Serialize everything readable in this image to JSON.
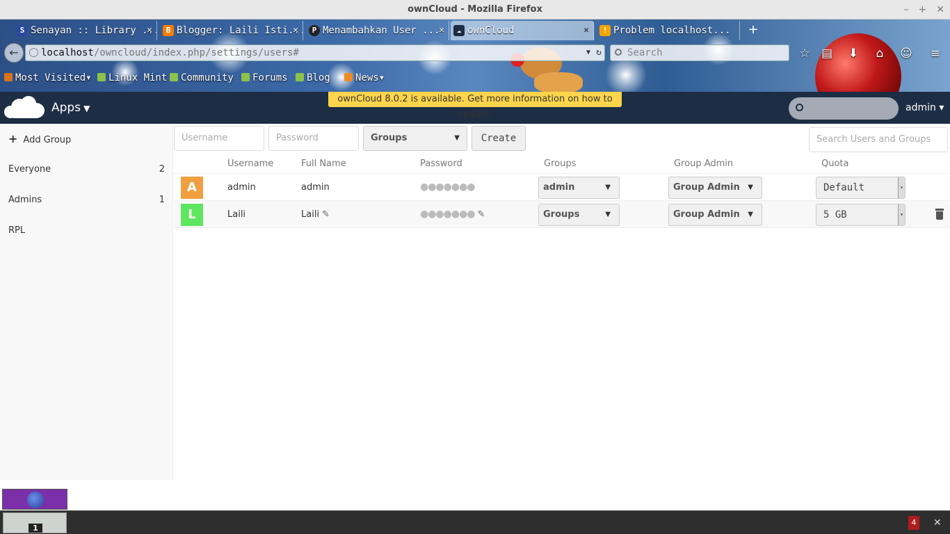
{
  "window": {
    "title": "ownCloud - Mozilla Firefox",
    "minimize": "–",
    "maximize": "+",
    "close": "✕"
  },
  "browser": {
    "tabs": [
      {
        "label": "Senayan :: Library ...",
        "icon_color": "#2a4a9c",
        "icon": "S",
        "icon_name": "senayan-icon"
      },
      {
        "label": "Blogger: Laili Isti...",
        "icon_color": "#f57d00",
        "icon": "B",
        "icon_name": "blogger-icon"
      },
      {
        "label": "Menambahkan User ...",
        "icon_color": "#222222",
        "icon": "P",
        "icon_name": "pinterest-icon"
      },
      {
        "label": "ownCloud",
        "icon_color": "#1d2d44",
        "icon": "☁",
        "icon_name": "owncloud-icon"
      },
      {
        "label": "Problem localhost...",
        "icon_color": "#f5a500",
        "icon": "!",
        "icon_name": "problem-icon"
      }
    ],
    "tab_close": "✕",
    "new_tab": "+",
    "url_host": "localhost",
    "url_path": "/owncloud/index.php/settings/users#",
    "search_placeholder": "Search",
    "bookmarks": [
      {
        "label": "Most Visited",
        "caret": "▾"
      },
      {
        "label": "Linux Mint",
        "caret": ""
      },
      {
        "label": "Community",
        "caret": ""
      },
      {
        "label": "Forums",
        "caret": ""
      },
      {
        "label": "Blog",
        "caret": ""
      },
      {
        "label": "News",
        "caret": "▾"
      }
    ]
  },
  "owncloud": {
    "apps_label": "Apps",
    "apps_caret": "▼",
    "update_notice": "ownCloud 8.0.2 is available. Get more information on how to update.",
    "user": "admin ▾"
  },
  "sidebar": {
    "add_group": "Add Group",
    "groups": [
      {
        "name": "Everyone",
        "count": "2"
      },
      {
        "name": "Admins",
        "count": "1"
      },
      {
        "name": "RPL",
        "count": ""
      }
    ]
  },
  "create_form": {
    "username_placeholder": "Username",
    "password_placeholder": "Password",
    "groups_select": "Groups",
    "create_button": "Create",
    "search_placeholder": "Search Users and Groups"
  },
  "table": {
    "headers": [
      "Username",
      "Full Name",
      "Password",
      "Groups",
      "Group Admin",
      "Quota"
    ],
    "rows": [
      {
        "avatar": "A",
        "avatar_color": "#f0a040",
        "username": "admin",
        "fullname": "admin",
        "password": "●●●●●●●",
        "groups": "admin",
        "group_admin": "Group Admin",
        "quota": "Default"
      },
      {
        "avatar": "L",
        "avatar_color": "#5ee65e",
        "username": "Laili",
        "fullname": "Laili",
        "password": "●●●●●●●",
        "groups": "Groups",
        "group_admin": "Group Admin",
        "quota": "5 GB"
      }
    ]
  },
  "taskbar": {
    "workspace": "1",
    "tray_badge": "4",
    "tray_close": "✕"
  }
}
